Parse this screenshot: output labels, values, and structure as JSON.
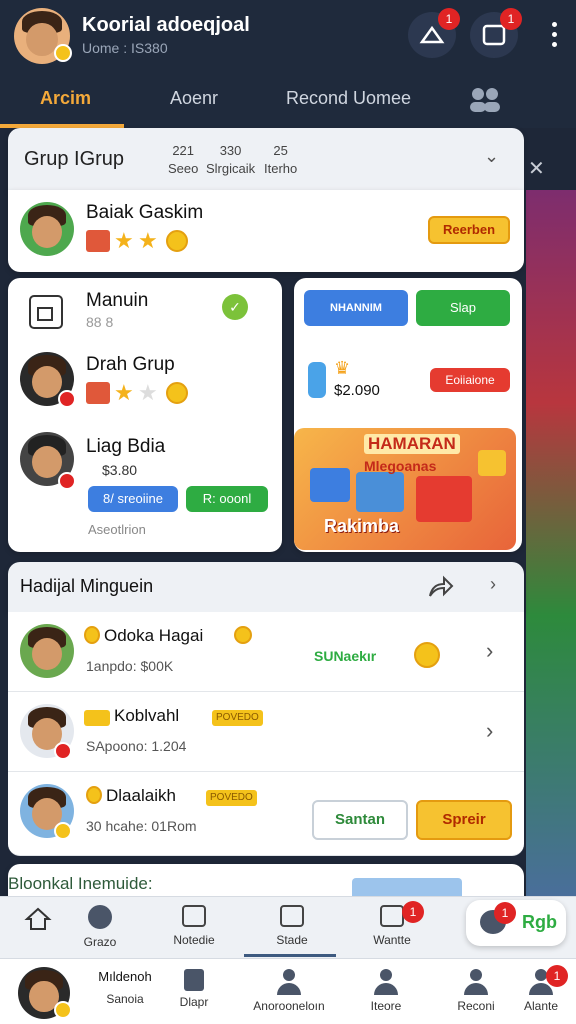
{
  "header": {
    "title": "Koorial adoeqjoal",
    "subtitle": "Uome : IS380",
    "notif_badge_1": "1",
    "notif_badge_2": "1"
  },
  "tabs": [
    {
      "label": "Arcim",
      "active": true
    },
    {
      "label": "Aoenr"
    },
    {
      "label": "Recond Uomee"
    }
  ],
  "group": {
    "title": "Grup IGrup",
    "stats": [
      {
        "value": "221",
        "label": "Seeo"
      },
      {
        "value": "330",
        "label": "Slrgicaik"
      },
      {
        "value": "25",
        "label": "Iterho"
      }
    ],
    "member": {
      "name": "Baiak Gaskim",
      "button": "Reerben"
    }
  },
  "friends": [
    {
      "name": "Manuin",
      "sub": "88 8"
    },
    {
      "name": "Drah Grup"
    },
    {
      "name": "Liag Bdia",
      "sub": "$3.80",
      "btn_blue": "8/ sreoiine",
      "btn_green": "R: ooonl"
    }
  ],
  "friends_footer": "Aseotlrion",
  "promo": {
    "btn_blue": "NHANNIM",
    "btn_green": "Slap",
    "amount": "$2.090",
    "btn_red": "Eoiiaione",
    "title": "HAMARAN",
    "subtitle": "Mlegoanas",
    "footer": "Rakimba"
  },
  "list": {
    "title": "Hadijal Minguein",
    "rows": [
      {
        "name": "Odoka Hagai",
        "sub": "1anpdo: $00K",
        "status": "SUNaekır"
      },
      {
        "name": "Koblvahl",
        "sub": "SApoono: 1.204",
        "tag": "POVEDO"
      },
      {
        "name": "Dlaalaikh",
        "sub": "30 hcahe: 01Rom",
        "tag": "POVEDO",
        "btn_white": "Santan",
        "btn_orange": "Spreir"
      }
    ],
    "partial_title": "Bloonkal Inemuide:"
  },
  "nav_primary": [
    {
      "label": ""
    },
    {
      "label": "Grazo"
    },
    {
      "label": "Notedie"
    },
    {
      "label": "Stade"
    },
    {
      "label": "Wantte",
      "badge": "1"
    }
  ],
  "rgb_button": {
    "label": "Rgb",
    "badge": "1"
  },
  "nav_secondary": [
    {
      "label": "Sanoia",
      "top": "Mıldenoh"
    },
    {
      "label": "Dlapr"
    },
    {
      "label": "Anorooneloın"
    },
    {
      "label": "Iteore"
    },
    {
      "label": "Reconi"
    },
    {
      "label": "Alante",
      "badge": "1"
    }
  ],
  "colors": {
    "header_bg": "#1f2a3c",
    "accent": "#f4a93a",
    "green": "#2eac42",
    "blue": "#3d7ee0",
    "red": "#e02424"
  }
}
